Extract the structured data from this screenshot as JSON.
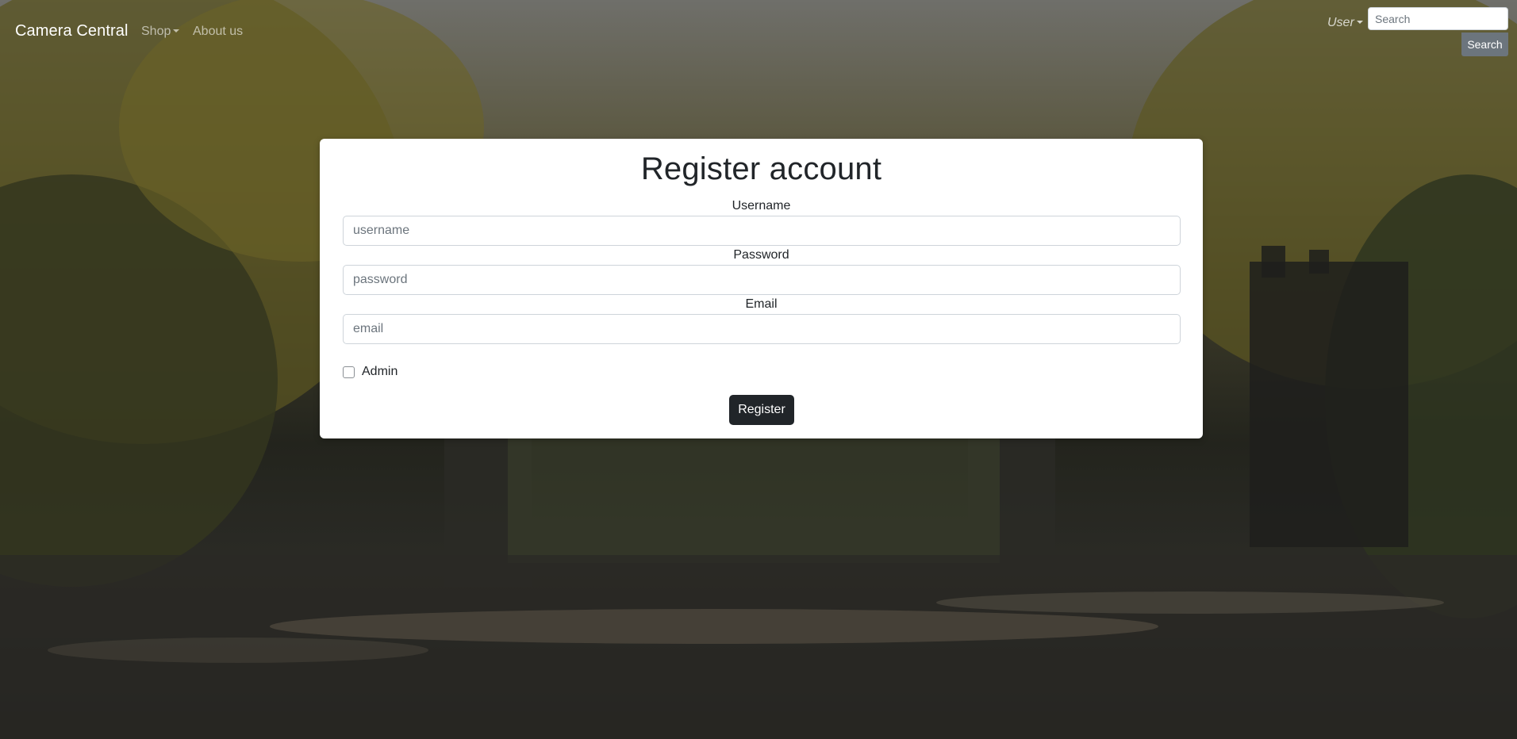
{
  "navbar": {
    "brand": "Camera Central",
    "shop_label": "Shop",
    "about_label": "About us",
    "user_label": "User",
    "search_placeholder": "Search",
    "search_button": "Search"
  },
  "form": {
    "title": "Register account",
    "username_label": "Username",
    "username_placeholder": "username",
    "password_label": "Password",
    "password_placeholder": "password",
    "email_label": "Email",
    "email_placeholder": "email",
    "admin_label": "Admin",
    "admin_checked": false,
    "register_button": "Register"
  },
  "colors": {
    "primary_button": "#212529",
    "secondary_button": "#6c757d",
    "card_background": "#ffffff"
  }
}
